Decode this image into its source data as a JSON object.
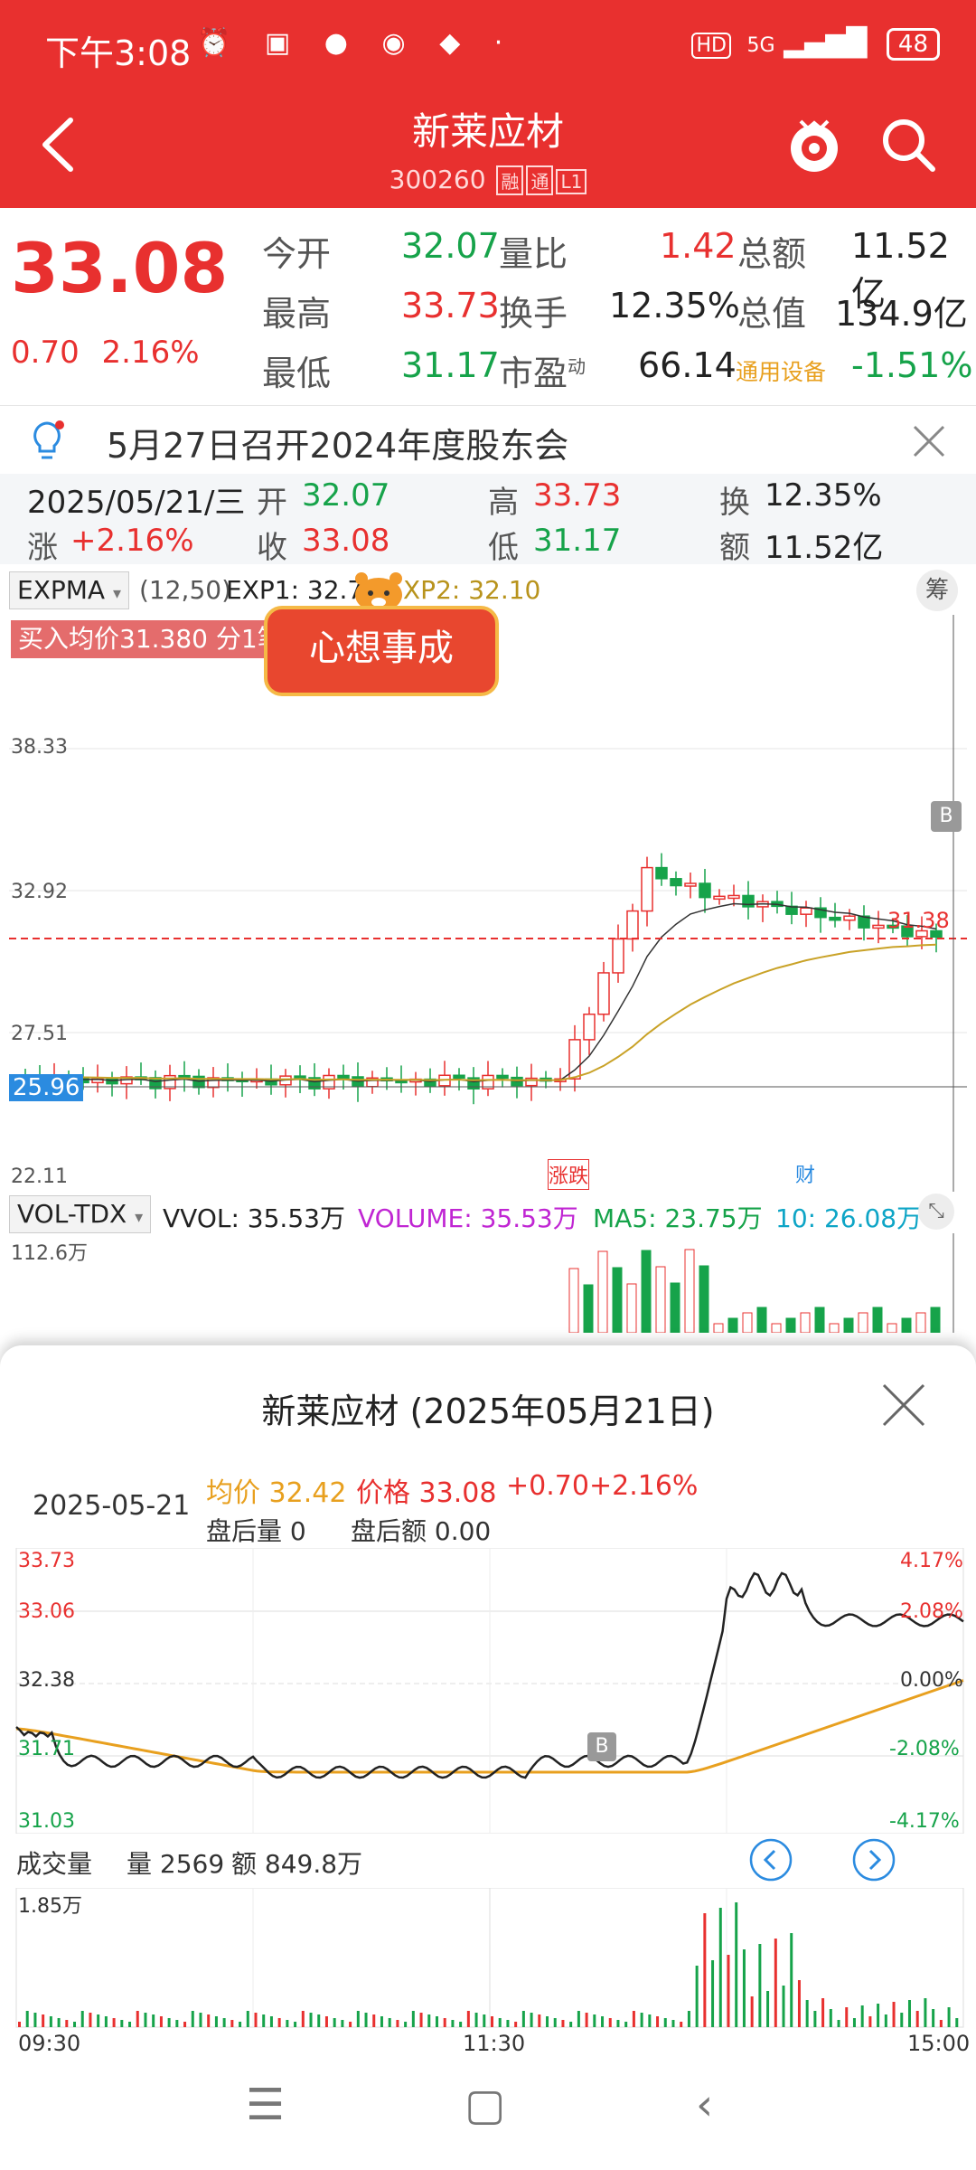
{
  "status_bar": {
    "time": "下午3:08",
    "signal": "5G",
    "battery": "48"
  },
  "header": {
    "title": "新莱应材",
    "code": "300260",
    "tags": [
      "融",
      "通",
      "L1"
    ]
  },
  "quote": {
    "price": "33.08",
    "change": "0.70",
    "change_pct": "2.16%",
    "rows": [
      {
        "l1": "今开",
        "v1": "32.07",
        "l2": "量比",
        "v2": "1.42",
        "l3": "总额",
        "v3": "11.52亿"
      },
      {
        "l1": "最高",
        "v1": "33.73",
        "l2": "换手",
        "v2": "12.35%",
        "l3": "总值",
        "v3": "134.9亿"
      },
      {
        "l1": "最低",
        "v1": "31.17",
        "l2": "市盈",
        "l2sup": "动",
        "v2": "66.14",
        "l3": "通用设备",
        "v3": "-1.51%"
      }
    ]
  },
  "notice": {
    "text": "5月27日召开2024年度股东会"
  },
  "ohlc_bar": {
    "date": "2025/05/21/三",
    "open_label": "开",
    "open": "32.07",
    "high_label": "高",
    "high": "33.73",
    "turnover_label": "换",
    "turnover": "12.35%",
    "change_label": "涨",
    "change": "+2.16%",
    "close_label": "收",
    "close": "33.08",
    "low_label": "低",
    "low": "31.17",
    "amount_label": "额",
    "amount": "11.52亿"
  },
  "kline": {
    "indicator": "EXPMA",
    "params": "(12,50)",
    "exp1": "EXP1: 32.7",
    "exp2": "XP2: 32.10",
    "fq_btn": "筹",
    "buy_label": "买入均价31.380 分1笔",
    "tiger_text": "心想事成",
    "y_ticks": [
      "38.33",
      "32.92",
      "27.51",
      "22.11"
    ],
    "current_marker": "25.96",
    "right_marker": "31.38",
    "b_marker": "B",
    "event_markers": [
      "涨跌",
      "财"
    ]
  },
  "volume": {
    "indicator": "VOL-TDX",
    "vvol": "VVOL: 35.53万",
    "volume": "VOLUME: 35.53万",
    "ma5": "MA5: 23.75万",
    "ma10": "10: 26.08万",
    "y_max": "112.6万"
  },
  "intraday": {
    "title": "新莱应材 (2025年05月21日)",
    "date": "2025-05-21",
    "avg_price": "均价 32.42",
    "price": "价格 33.08",
    "change": "+0.70",
    "change_pct": "+2.16%",
    "after_vol": "盘后量 0",
    "after_amt": "盘后额 0.00",
    "left_ticks": [
      "33.73",
      "33.06",
      "32.38",
      "31.71",
      "31.03"
    ],
    "right_ticks": [
      "4.17%",
      "2.08%",
      "0.00%",
      "-2.08%",
      "-4.17%"
    ],
    "b_marker": "B",
    "volume_label": "成交量",
    "volume_value": "量 2569",
    "amount_value": "额 849.8万",
    "vol_max": "1.85万",
    "time_ticks": [
      "09:30",
      "11:30",
      "15:00"
    ]
  },
  "colors": {
    "brand_red": "#E8302F",
    "up": "#E8302F",
    "down": "#16A34A",
    "exp1": "#333333",
    "exp2": "#C9A227"
  }
}
